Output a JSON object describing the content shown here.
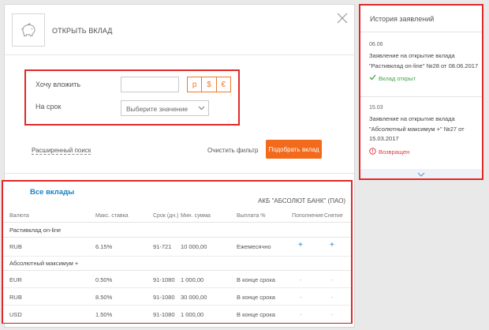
{
  "header": {
    "title": "ОТКРЫТЬ ВКЛАД",
    "icon": "piggy-bank-icon",
    "close_icon": "close-icon"
  },
  "form": {
    "amount_label": "Хочу вложить",
    "amount_value": "",
    "currencies": [
      "р",
      "$",
      "€"
    ],
    "term_label": "На срок",
    "term_select_value": "Выберите значение",
    "advanced_search": "Расширенный поиск",
    "clear_filter": "Очистить фильтр",
    "submit": "Подобрать вклад"
  },
  "deposits": {
    "title": "Все вклады",
    "bank": "АКБ \"АБСОЛЮТ БАНК\" (ПАО)",
    "columns": [
      "Валюта",
      "Макс. ставка",
      "Срок (дн.)",
      "Мин. сумма",
      "Выплата %",
      "Пополнение",
      "Снятие"
    ],
    "groups": [
      {
        "name": "Растивклад on-line",
        "rows": [
          {
            "currency": "RUB",
            "rate": "6.15%",
            "term": "91-721",
            "min": "10 000,00",
            "payout": "Ежемесячно",
            "topup": "+",
            "withdraw": "+"
          }
        ]
      },
      {
        "name": "Абсолютный максимум +",
        "rows": [
          {
            "currency": "EUR",
            "rate": "0.50%",
            "term": "91-1080",
            "min": "1 000,00",
            "payout": "В конце срока",
            "topup": "-",
            "withdraw": "-"
          },
          {
            "currency": "RUB",
            "rate": "8.50%",
            "term": "91-1080",
            "min": "30 000,00",
            "payout": "В конце срока",
            "topup": "-",
            "withdraw": "-"
          },
          {
            "currency": "USD",
            "rate": "1.50%",
            "term": "91-1080",
            "min": "1 000,00",
            "payout": "В конце срока",
            "topup": "-",
            "withdraw": "-"
          }
        ]
      }
    ]
  },
  "history": {
    "title": "История заявлений",
    "items": [
      {
        "date": "06.06",
        "text": "Заявление на открытие вклада \"Растивклад on-line\" №28 от 08.06.2017",
        "status": "Вклад открыт",
        "status_type": "ok"
      },
      {
        "date": "15.03",
        "text": "Заявление на открытие вклада \"Абсолютный максимум +\" №27 от 15.03.2017",
        "status": "Возвращен",
        "status_type": "returned"
      }
    ]
  },
  "colors": {
    "accent": "#f26a1b",
    "link": "#1a7fc6",
    "highlight": "#e02828"
  }
}
